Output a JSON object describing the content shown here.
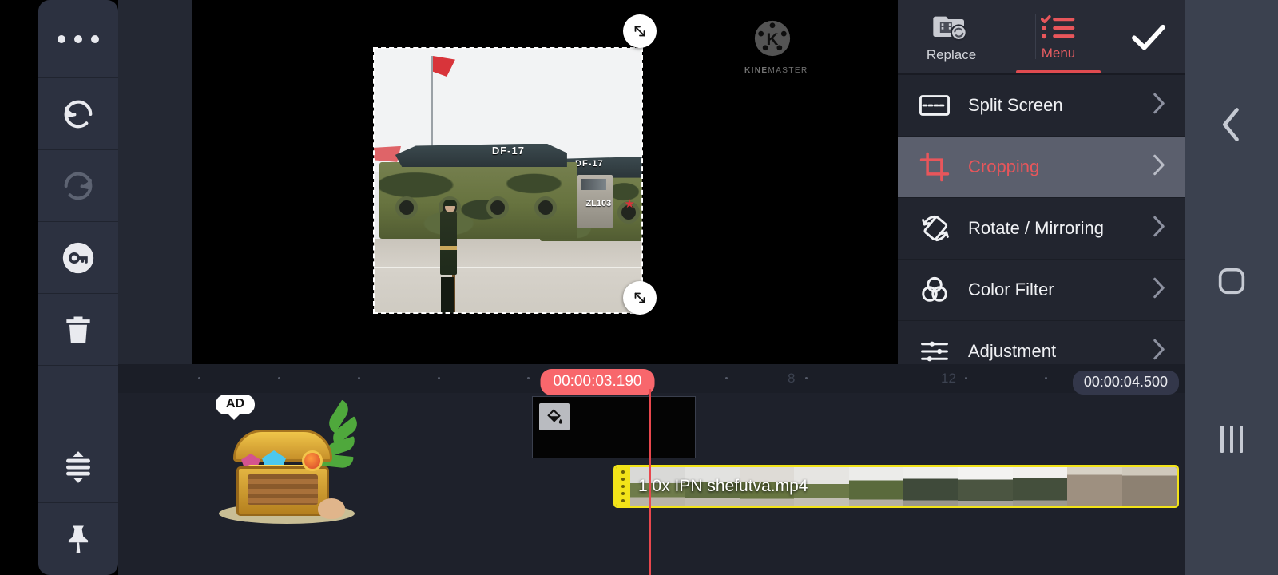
{
  "app": {
    "name": "KineMaster",
    "watermark_text": "KINEMASTER",
    "watermark_prefix": "KINE",
    "watermark_suffix": "MASTER"
  },
  "left_toolbar": {
    "items": [
      {
        "name": "more-options",
        "label": "More options",
        "icon": "more-dots-icon",
        "enabled": true
      },
      {
        "name": "undo",
        "label": "Undo",
        "icon": "undo-icon",
        "enabled": true
      },
      {
        "name": "redo",
        "label": "Redo",
        "icon": "redo-icon",
        "enabled": false
      },
      {
        "name": "lock",
        "label": "Lock",
        "icon": "key-icon",
        "enabled": true
      },
      {
        "name": "delete",
        "label": "Delete",
        "icon": "trash-icon",
        "enabled": true
      },
      {
        "name": "expand-timeline",
        "label": "Expand timeline",
        "icon": "expand-vertical-icon",
        "enabled": true
      },
      {
        "name": "pin",
        "label": "Pin",
        "icon": "pin-icon",
        "enabled": true
      }
    ]
  },
  "preview": {
    "crop_overlay": true,
    "handles": [
      {
        "name": "crop-handle-top-right",
        "icon": "resize-diagonal-icon"
      },
      {
        "name": "crop-handle-bottom-right",
        "icon": "resize-diagonal-icon"
      }
    ],
    "video_labels": {
      "missile_primary": "DF-17",
      "missile_secondary": "DF-17",
      "vehicle_id": "ZL103"
    }
  },
  "right_panel": {
    "tabs": [
      {
        "id": "replace",
        "label": "Replace",
        "icon": "replace-media-icon",
        "active": false
      },
      {
        "id": "menu",
        "label": "Menu",
        "icon": "checklist-icon",
        "active": true
      }
    ],
    "confirm": {
      "label": "Confirm",
      "icon": "check-icon"
    },
    "menu_items": [
      {
        "id": "split-screen",
        "label": "Split Screen",
        "icon": "split-screen-icon",
        "selected": false,
        "chevron": "chevron-right-icon"
      },
      {
        "id": "cropping",
        "label": "Cropping",
        "icon": "crop-icon",
        "selected": true,
        "chevron": "chevron-right-icon"
      },
      {
        "id": "rotate-mirroring",
        "label": "Rotate / Mirroring",
        "icon": "rotate-icon",
        "selected": false,
        "chevron": "chevron-right-icon"
      },
      {
        "id": "color-filter",
        "label": "Color Filter",
        "icon": "color-filter-icon",
        "selected": false,
        "chevron": "chevron-right-icon"
      },
      {
        "id": "adjustment",
        "label": "Adjustment",
        "icon": "adjustment-icon",
        "selected": false,
        "chevron": "chevron-right-icon"
      }
    ]
  },
  "timeline": {
    "playhead_time": "00:00:03.190",
    "total_time": "00:00:04.500",
    "ruler_labels": [
      "8",
      "12"
    ],
    "layer_clip": {
      "name": "solid-color-layer",
      "icon": "paint-bucket-icon"
    },
    "video_clip": {
      "title": "1.0x IPN shefutva.mp4",
      "speed": "1.0x",
      "filename": "IPN shefutva.mp4",
      "selected": true,
      "handle_icon": "clip-trim-handle"
    },
    "ad": {
      "label": "AD",
      "art": "treasure-chest"
    }
  },
  "navbar": {
    "buttons": [
      {
        "id": "back",
        "label": "Back",
        "icon": "chevron-left-icon"
      },
      {
        "id": "home",
        "label": "Home",
        "icon": "home-square-icon"
      },
      {
        "id": "recents",
        "label": "Recents",
        "icon": "recents-bars-icon"
      }
    ]
  },
  "colors": {
    "accent_red": "#e8565b",
    "playhead_red": "#f8676c",
    "clip_yellow": "#f2e319",
    "panel_bg": "#22252f",
    "toolbar_bg": "#2c3140",
    "timeline_bg": "#1e212b",
    "navbar_bg": "#3b414f",
    "selected_row": "#5b5f6d"
  }
}
